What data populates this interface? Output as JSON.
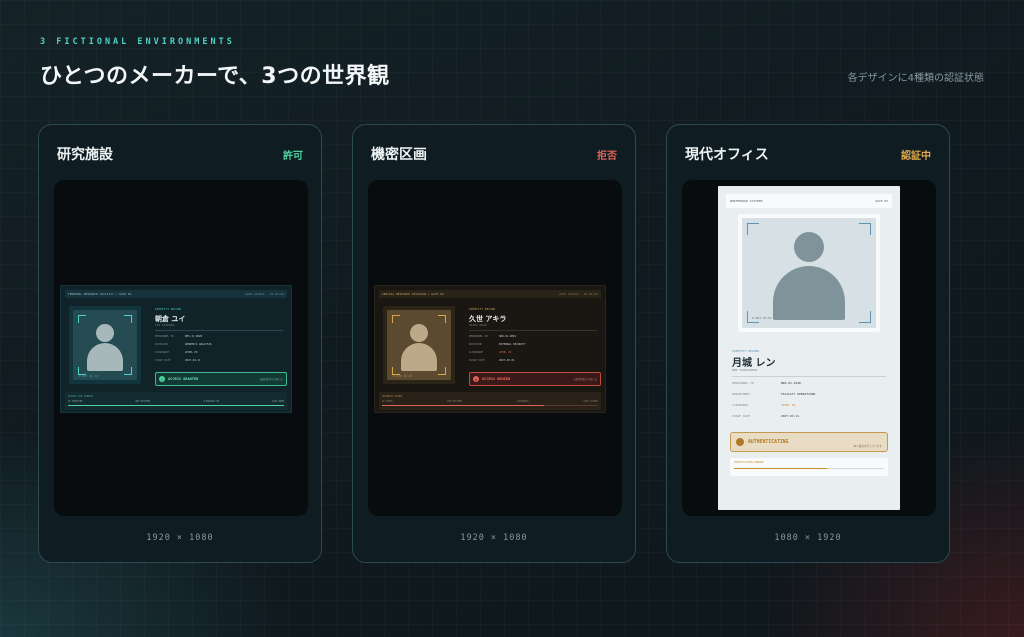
{
  "header": {
    "kicker": "3 FICTIONAL ENVIRONMENTS",
    "title": "ひとつのメーカーで、3つの世界観",
    "subtitle": "各デザインに4種類の認証状態"
  },
  "cards": [
    {
      "title": "研究施設",
      "status": "許可",
      "status_color": "#4fd1a0",
      "dimensions": "1920 × 1080",
      "screen": {
        "topbar_left": "TERMINAL RESEARCH FACILITY / GATE 04",
        "topbar_right": "GATE ACCESS · 03.04.02",
        "id_caption": "IDENTITY RECORD",
        "name": "朝倉 ユイ",
        "roman": "YUI ASAKURA",
        "photo_id": "P-001  ID-01",
        "fields": [
          {
            "k": "PERSONNEL ID",
            "v": "RES-17-0020"
          },
          {
            "k": "DIVISION",
            "v": "GENOMICS ANALYSIS"
          },
          {
            "k": "CLEARANCE",
            "v": "LEVEL 03"
          },
          {
            "k": "ISSUE DATE",
            "v": "2027-04-11"
          }
        ],
        "status_text": "ACCESS GRANTED",
        "status_aux": "入館が許可されました",
        "bottom_header": "ACCESS LOG STREAM",
        "ticks": [
          "ID VERIFIED",
          "BIO MATCHED",
          "CLEARANCE OK",
          "GATE OPEN"
        ],
        "accent": "#4fd1a0"
      }
    },
    {
      "title": "機密区画",
      "status": "拒否",
      "status_color": "#e0605a",
      "dimensions": "1920 × 1080",
      "screen": {
        "topbar_left": "SPECIAL RESEARCH DIVISION / GATE 00",
        "topbar_right": "GATE ACCESS · 00.00.00",
        "id_caption": "IDENTITY RECORD",
        "name": "久世 アキラ",
        "roman": "AKIRA KUZE",
        "photo_id": "P-000  ID-00",
        "fields": [
          {
            "k": "PERSONNEL ID",
            "v": "SRD-01-0001"
          },
          {
            "k": "DIVISION",
            "v": "EXTERNAL SECURITY"
          },
          {
            "k": "CLEARANCE",
            "v": "LEVEL 02"
          },
          {
            "k": "ISSUE DATE",
            "v": "2027-03-01"
          }
        ],
        "status_text": "ACCESS DENIED",
        "status_aux": "入館が拒否されました",
        "bottom_header": "SECURITY ALERT",
        "ticks": [
          "ID CHECK",
          "BIO MATCHED",
          "CLEARANCE",
          "GATE LOCKED"
        ],
        "accent": "#e0605a"
      }
    },
    {
      "title": "現代オフィス",
      "status": "認証中",
      "status_color": "#e0a84a",
      "dimensions": "1080 × 1920",
      "screen": {
        "topbar_left": "NORTHRIDGE SYSTEMS",
        "topbar_right": "GATE 03",
        "id_caption": "IDENTITY RECORD",
        "name": "月城 レン",
        "roman": "REN TSUKISHIRO",
        "photo_id": "P-003  ID-03",
        "fields": [
          {
            "k": "PERSONNEL ID",
            "v": "NRS-01-1040"
          },
          {
            "k": "DEPARTMENT",
            "v": "FACILITY OPERATIONS"
          },
          {
            "k": "CLEARANCE",
            "v": "LEVEL 02"
          },
          {
            "k": "ISSUE DATE",
            "v": "2027-03-11"
          }
        ],
        "status_text": "AUTHENTICATING",
        "status_aux": "本人確認を行っています",
        "bottom_header": "VERIFICATION ENGINE",
        "progress": 0.62,
        "accent": "#c68c2e"
      }
    }
  ]
}
